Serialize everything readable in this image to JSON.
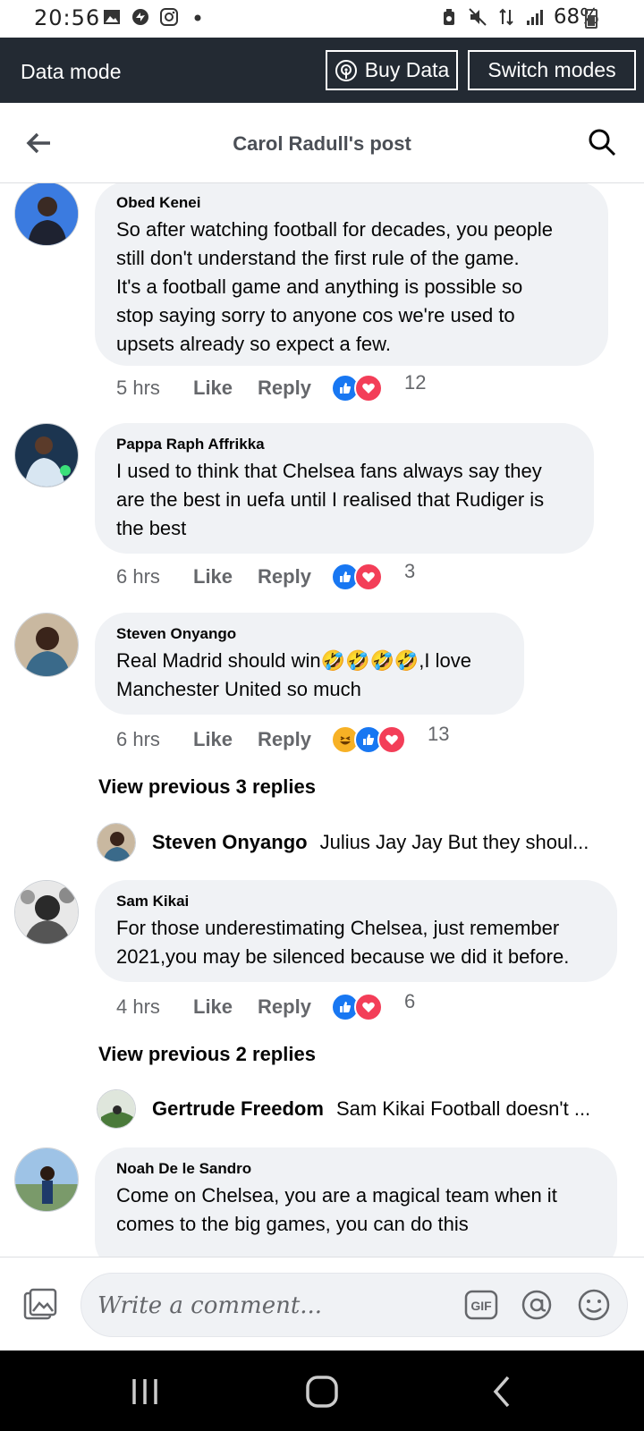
{
  "status_bar": {
    "time": "20:56",
    "battery": "68%"
  },
  "data_bar": {
    "label": "Data mode",
    "buy_data": "Buy Data",
    "switch_modes": "Switch modes"
  },
  "header": {
    "title": "Carol Radull's post"
  },
  "comments": [
    {
      "author": "Obed Kenei",
      "text": "So after watching football for decades, you people\nstill don't understand the first rule of the game.\nIt's a football game and anything is possible so\nstop saying sorry to anyone  cos we're used to\nupsets already so expect a few.",
      "time": "5 hrs",
      "like": "Like",
      "reply": "Reply",
      "reaction_count": "12"
    },
    {
      "author": "Pappa Raph Affrikka",
      "text": "I used to think that Chelsea fans always say they\nare the best in uefa until I realised that Rudiger is\nthe best",
      "time": "6 hrs",
      "like": "Like",
      "reply": "Reply",
      "reaction_count": "3"
    },
    {
      "author": "Steven Onyango",
      "text": "Real Madrid should win🤣🤣🤣🤣,I love\nManchester United so much",
      "time": "6 hrs",
      "like": "Like",
      "reply": "Reply",
      "reaction_count": "13",
      "view_previous": "View previous 3 replies",
      "latest_reply": {
        "author": "Steven Onyango",
        "text": "Julius Jay Jay But they shoul..."
      }
    },
    {
      "author": "Sam Kikai",
      "text": "For those underestimating Chelsea, just remember\n2021,you may be silenced because we did it before.",
      "time": "4 hrs",
      "like": "Like",
      "reply": "Reply",
      "reaction_count": "6",
      "view_previous": "View previous 2 replies",
      "latest_reply": {
        "author": "Gertrude Freedom",
        "text": "Sam Kikai Football doesn't ..."
      }
    },
    {
      "author": "Noah De le Sandro",
      "text": "Come on Chelsea, you are a magical team when it\ncomes to the big games, you can do this"
    }
  ],
  "composer": {
    "placeholder": "Write a comment...",
    "gif_label": "GIF"
  },
  "colors": {
    "like_blue": "#1877f2",
    "love_red": "#f33e58",
    "haha_yellow": "#f7b125",
    "bubble_bg": "#f0f2f5",
    "data_bar_bg": "#232a33"
  }
}
